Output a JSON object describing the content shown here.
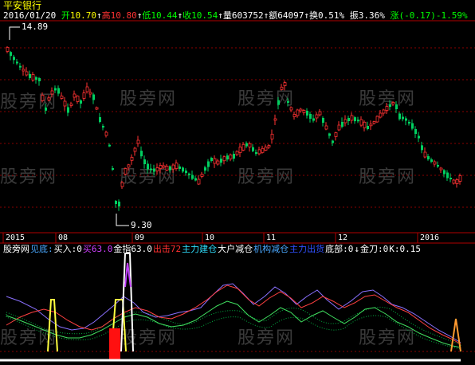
{
  "stock": {
    "name": "平安银行"
  },
  "header": {
    "date": "2016/01/20",
    "open_label": "开",
    "open_value": "10.70",
    "high_label": "高",
    "high_value": "10.80",
    "low_label": "低",
    "low_value": "10.44",
    "close_label": "收",
    "close_value": "10.54",
    "volume_label": "量",
    "volume_value": "603752",
    "amount_label": "额",
    "amount_value": "64097",
    "turnover_label": "换",
    "turnover_value": "0.51%",
    "amplitude_label": "振",
    "amplitude_value": "3.36%",
    "change_label": "涨",
    "change_value": "(-0.17)",
    "change_pct": "-1.59%",
    "arrow": "↑"
  },
  "price_chart": {
    "max_label": "14.89",
    "min_label": "9.30",
    "watermark": "股旁网",
    "months": [
      "2015",
      "08",
      "09",
      "10",
      "11",
      "12",
      "2016"
    ]
  },
  "indicator": {
    "labels": [
      {
        "text": "股旁网",
        "color": "#ffffff"
      },
      {
        "text": "见底:",
        "color": "#4aa8ff"
      },
      {
        "text": "买入:0",
        "color": "#ffffff"
      },
      {
        "text": "买63.0",
        "color": "#d040ff"
      },
      {
        "text": "金指63.0",
        "color": "#ffffff"
      },
      {
        "text": "出击72",
        "color": "#ff3030"
      },
      {
        "text": "主力建仓",
        "color": "#30e0ff"
      },
      {
        "text": "大户减仓",
        "color": "#ffffff"
      },
      {
        "text": "机构减仓",
        "color": "#4aa8ff"
      },
      {
        "text": "主力出货",
        "color": "#3050ff"
      },
      {
        "text": "底部:0",
        "color": "#ffffff"
      },
      {
        "text": "↓",
        "color": "#ffffff"
      },
      {
        "text": "金刀:0",
        "color": "#ffffff"
      },
      {
        "text": "K:0.15",
        "color": "#ffffff"
      }
    ]
  },
  "colors": {
    "up": "#ff3232",
    "down": "#00d060",
    "axis": "#b00000",
    "grid": "#8a0000",
    "label_yellow": "#ffff00",
    "label_green": "#00ff00"
  }
}
